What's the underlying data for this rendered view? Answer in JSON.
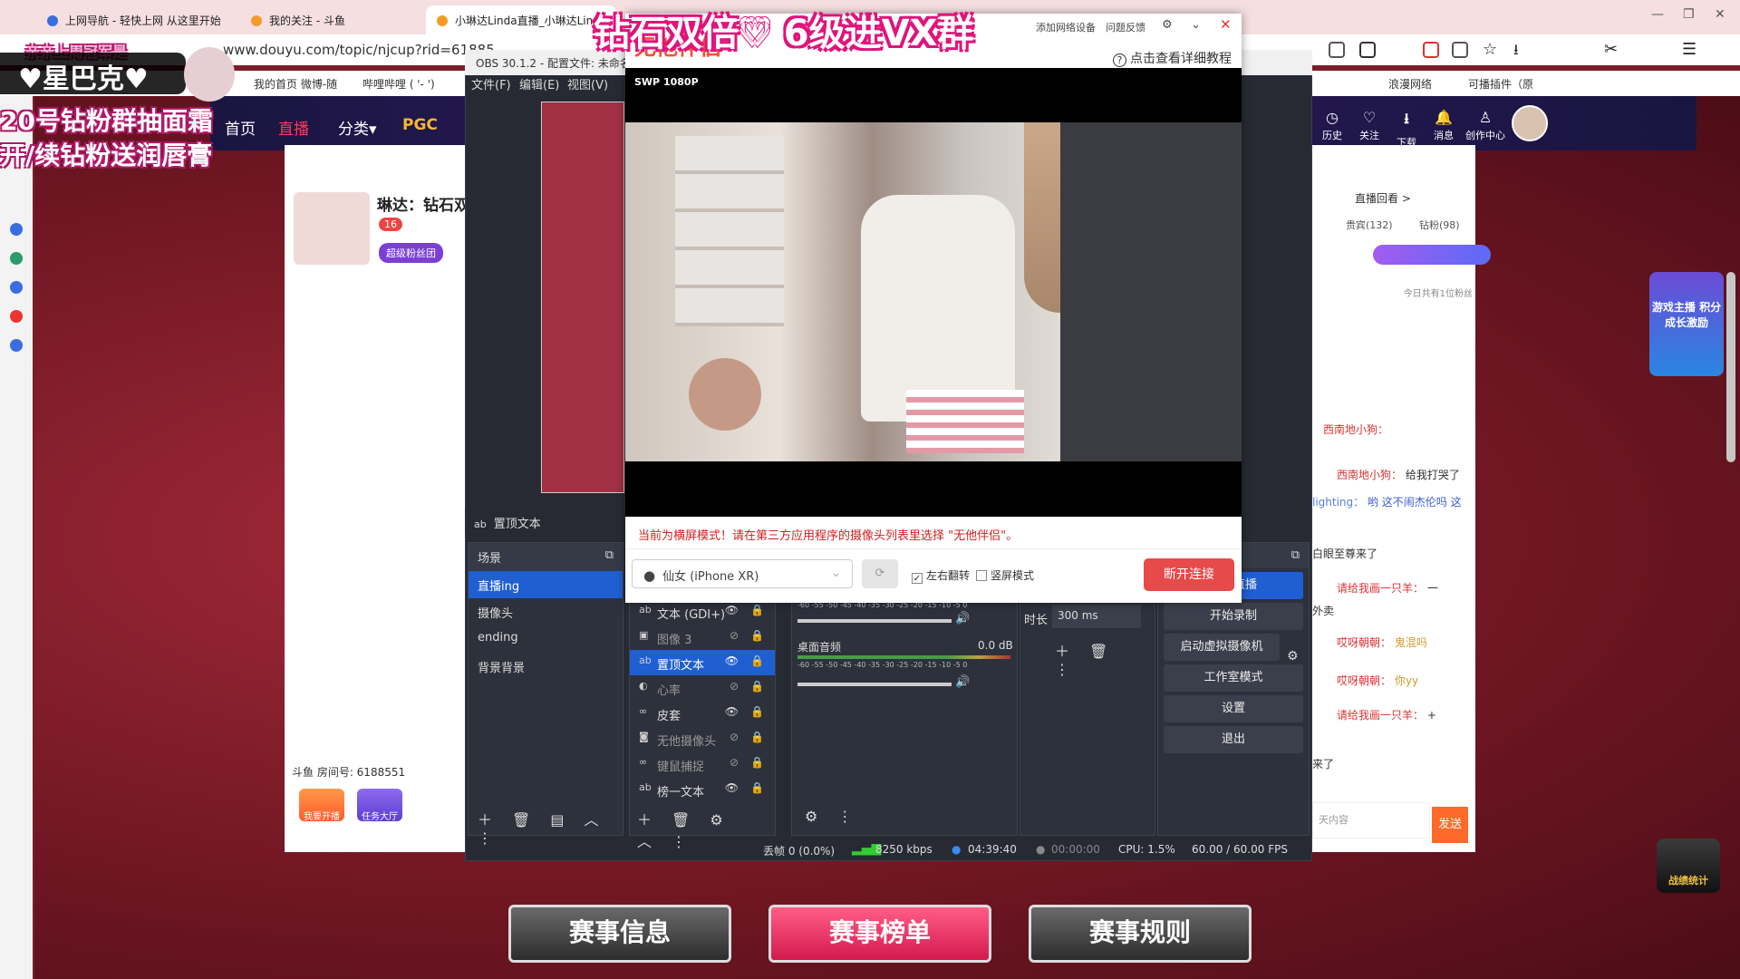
{
  "browser": {
    "tabs": [
      {
        "label": "上网导航 - 轻快上网 从这里开始"
      },
      {
        "label": "我的关注 - 斗鱼"
      },
      {
        "label": "小琳达Linda直播_小琳达Lind"
      }
    ],
    "url": "www.douyu.com/topic/njcup?rid=61885",
    "bookmarks": [
      "我的首页 微博-随",
      "哔哩哔哩 ( '- ')",
      "浪漫网络",
      "可播插件（原"
    ]
  },
  "site": {
    "nav": [
      "首页",
      "直播",
      "分类▾",
      "PGC"
    ],
    "nav_icons": [
      {
        "icon": "history-icon",
        "label": "历史"
      },
      {
        "icon": "heart-icon",
        "label": "关注"
      },
      {
        "icon": "download-icon",
        "label": "下载"
      },
      {
        "icon": "bell-icon",
        "label": "消息"
      },
      {
        "icon": "creator-icon",
        "label": "创作中心"
      }
    ],
    "room_label": "直播回看 >",
    "tabs": [
      "贵宾(132)",
      "钻粉(98)"
    ],
    "fans_today": "今日共有1位粉丝",
    "room_number": "斗鱼 房间号: 6188551",
    "broadcaster": "琳达：钻石双",
    "badge": "16",
    "fanclub": "超级粉丝团",
    "buttons": [
      "我要开播",
      "任务大厅"
    ],
    "chat": [
      {
        "user": "西南地小狗：",
        "text": "给我打哭了"
      },
      {
        "user": "lighting：",
        "text": "哟 这不闹杰伦吗 这"
      },
      {
        "user": "",
        "text": "白眼至尊来了"
      },
      {
        "user": "请给我画一只羊：",
        "text": "一"
      },
      {
        "user": "",
        "text": "外卖"
      },
      {
        "user": "哎呀朝朝：",
        "text": "鬼混吗"
      },
      {
        "user": "哎呀朝朝：",
        "text": "你yy"
      },
      {
        "user": "请给我画一只羊：",
        "text": "+"
      },
      {
        "user": "",
        "text": "来了"
      }
    ],
    "send_label": "发送",
    "chat_placeholder": "天内容",
    "promo": "游戏主播 积分成长激励"
  },
  "obs": {
    "title": "OBS 30.1.2 - 配置文件: 未命名",
    "menu": [
      "文件(F)",
      "编辑(E)",
      "视图(V)"
    ],
    "selected_source_label": "置顶文本",
    "scenes_header": "场景",
    "scenes": [
      "直播ing",
      "摄像头",
      "ending",
      "背景背景"
    ],
    "sources": [
      {
        "icon": "ab",
        "name": "文本 (GDI+)"
      },
      {
        "icon": "▣",
        "name": "图像 3"
      },
      {
        "icon": "ab",
        "name": "置顶文本"
      },
      {
        "icon": "◐",
        "name": "心率"
      },
      {
        "icon": "∞",
        "name": "皮套"
      },
      {
        "icon": "◙",
        "name": "无他摄像头"
      },
      {
        "icon": "∞",
        "name": "键鼠捕捉"
      },
      {
        "icon": "ab",
        "name": "榜一文本"
      }
    ],
    "audio": {
      "desktop_label": "桌面音频",
      "desktop_db": "0.0 dB",
      "ticks": "-60 -55 -50 -45 -40 -35 -30 -25 -20 -15 -10 -5 0"
    },
    "transition": {
      "label": "时长",
      "value": "300 ms"
    },
    "controls": [
      "停止直播",
      "开始录制",
      "启动虚拟摄像机",
      "工作室模式",
      "设置",
      "退出"
    ],
    "status": {
      "dropped": "丢帧 0 (0.0%)",
      "bitrate": "8250 kbps",
      "live_time": "04:39:40",
      "rec_time": "00:00:00",
      "cpu": "CPU: 1.5%",
      "fps": "60.00 / 60.00 FPS"
    }
  },
  "camera_app": {
    "logo": "无他伴侣",
    "toolbar": [
      "添加网络设备",
      "问题反馈"
    ],
    "help_link": "点击查看详细教程",
    "res_badge": "SWP 1080P",
    "warning": "当前为横屏模式！请在第三方应用程序的摄像头列表里选择 \"无他伴侣\"。",
    "device": "仙女 (iPhone XR)",
    "mirror_label": "左右翻转",
    "vertical_label": "竖屏模式",
    "disconnect_label": "断开连接"
  },
  "overlays": {
    "top_title": "钻石双倍♡ 6级进VX群",
    "corner_text": "亲亲上周冠军是",
    "name_tag": "♥星巴克♥",
    "promo_line1": "20号钻粉群抽面霜",
    "promo_line2": "开/续钻粉送润唇膏",
    "banners": [
      "赛事信息",
      "赛事榜单",
      "赛事规则"
    ],
    "stats_badge": "战绩统计"
  }
}
